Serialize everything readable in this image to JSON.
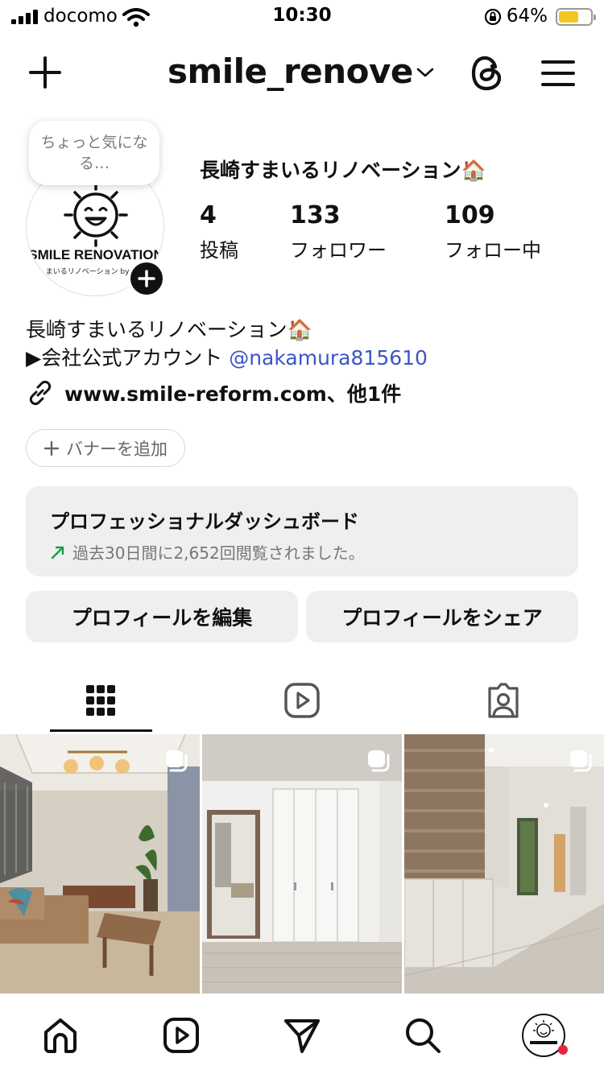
{
  "status_bar": {
    "carrier": "docomo",
    "time": "10:30",
    "battery_percent": "64%",
    "battery_level": 0.64,
    "icons": [
      "signal-icon",
      "wifi-icon",
      "orientation-lock-icon",
      "battery-icon"
    ]
  },
  "header": {
    "username": "smile_renove",
    "icons": [
      "plus-icon",
      "chevron-down-icon",
      "threads-icon",
      "menu-icon"
    ]
  },
  "profile": {
    "note": "ちょっと気になる…",
    "avatar_logo_text": "SMILE RENOVATION",
    "avatar_logo_sub": "まいるリノベーション by すま",
    "display_name": "長崎すまいるリノベーション🏠",
    "stats": [
      {
        "num": "4",
        "label": "投稿"
      },
      {
        "num": "133",
        "label": "フォロワー"
      },
      {
        "num": "109",
        "label": "フォロー中"
      }
    ],
    "bio_line1": "長崎すまいるリノベーション🏠",
    "bio_line2_prefix": "▶会社公式アカウント ",
    "bio_mention": "@nakamura815610",
    "link": "www.smile-reform.com、他1件",
    "banner_button": "バナーを追加"
  },
  "dashboard": {
    "title": "プロフェッショナルダッシュボード",
    "subtitle": "過去30日間に2,652回閲覧されました。"
  },
  "actions": {
    "edit": "プロフィールを編集",
    "share": "プロフィールをシェア"
  },
  "tabs": [
    "grid-icon",
    "reels-icon",
    "tagged-icon"
  ],
  "nav": [
    "home-icon",
    "reels-icon",
    "send-icon",
    "search-icon",
    "profile-avatar"
  ],
  "colors": {
    "mention": "#3a55c8",
    "button_bg": "#efeff1",
    "notification_dot": "#e8263b",
    "battery": "#f3c623"
  }
}
